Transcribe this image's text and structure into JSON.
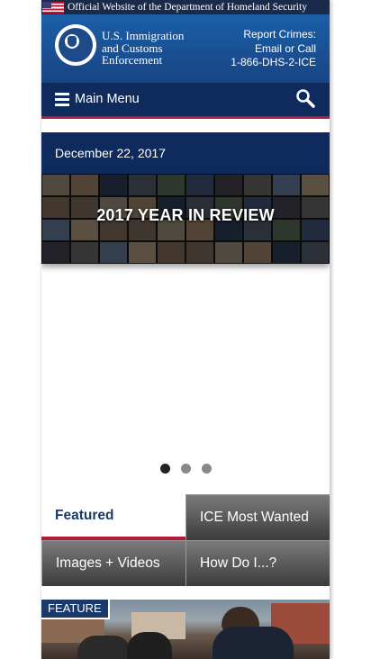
{
  "gov_banner": {
    "text": "Official Website of the Department of Homeland Security",
    "flag_icon": "us-flag-icon"
  },
  "header": {
    "agency_lines": [
      "U.S. Immigration",
      "and Customs",
      "Enforcement"
    ],
    "seal_icon": "dhs-seal-icon",
    "report_lines": [
      "Report Crimes:",
      "Email or Call",
      "1-866-DHS-2-ICE"
    ]
  },
  "menu": {
    "label": "Main Menu",
    "menu_icon": "hamburger-icon",
    "search_icon": "search-icon"
  },
  "slide": {
    "date": "December 22, 2017",
    "title": "2017 YEAR IN REVIEW"
  },
  "carousel": {
    "count": 3,
    "active": 1
  },
  "tabs": [
    {
      "label": "Featured",
      "active": true
    },
    {
      "label": "ICE Most Wanted",
      "active": false
    },
    {
      "label": "Images + Videos",
      "active": false
    },
    {
      "label": "How Do I...?",
      "active": false
    }
  ],
  "feature": {
    "badge": "FEATURE"
  },
  "colors": {
    "navy": "#0f2a5c",
    "header_blue": "#1a4f91",
    "accent_red": "#b31b3b",
    "tab_text": "#1b3a6b"
  }
}
